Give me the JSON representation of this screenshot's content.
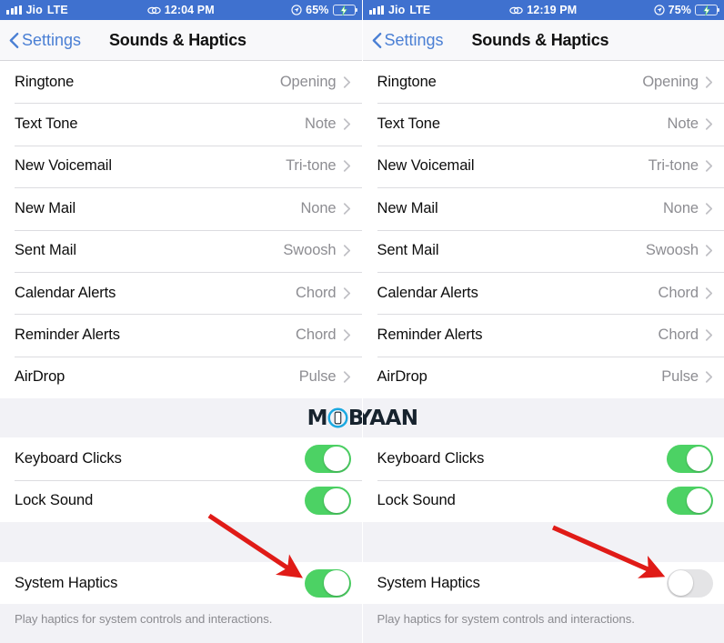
{
  "screens": [
    {
      "id": "before",
      "status_bar": {
        "signal_icon": "signal-bars-icon",
        "carrier": "Jio",
        "network": "LTE",
        "link_icon": "link-icon",
        "time": "12:04 PM",
        "location_icon": "location-arrow-icon",
        "battery_percent": "65%",
        "battery_icon": "battery-charging-icon",
        "battery_level": 65,
        "bar_color": "#3f71cf",
        "battery_fill_color": "#4cd55f"
      },
      "nav": {
        "back_icon": "chevron-left-icon",
        "back_label": "Settings",
        "title": "Sounds & Haptics"
      },
      "sound_rows": [
        {
          "label": "Ringtone",
          "value": "Opening",
          "accessory": "disclosure-chevron-icon"
        },
        {
          "label": "Text Tone",
          "value": "Note",
          "accessory": "disclosure-chevron-icon"
        },
        {
          "label": "New Voicemail",
          "value": "Tri-tone",
          "accessory": "disclosure-chevron-icon"
        },
        {
          "label": "New Mail",
          "value": "None",
          "accessory": "disclosure-chevron-icon"
        },
        {
          "label": "Sent Mail",
          "value": "Swoosh",
          "accessory": "disclosure-chevron-icon"
        },
        {
          "label": "Calendar Alerts",
          "value": "Chord",
          "accessory": "disclosure-chevron-icon"
        },
        {
          "label": "Reminder Alerts",
          "value": "Chord",
          "accessory": "disclosure-chevron-icon"
        },
        {
          "label": "AirDrop",
          "value": "Pulse",
          "accessory": "disclosure-chevron-icon"
        }
      ],
      "toggle_rows": [
        {
          "label": "Keyboard Clicks",
          "state": "on",
          "state_label": "On"
        },
        {
          "label": "Lock Sound",
          "state": "on",
          "state_label": "On"
        }
      ],
      "haptics_row": {
        "label": "System Haptics",
        "state": "on",
        "state_label": "On"
      },
      "footer_text": "Play haptics for system controls and interactions.",
      "annotation": {
        "type": "arrow",
        "color": "#e01b17",
        "points": "from upper-left to System Haptics toggle"
      }
    },
    {
      "id": "after",
      "status_bar": {
        "signal_icon": "signal-bars-icon",
        "carrier": "Jio",
        "network": "LTE",
        "link_icon": "link-icon",
        "time": "12:19 PM",
        "location_icon": "location-arrow-icon",
        "battery_percent": "75%",
        "battery_icon": "battery-charging-icon",
        "battery_level": 75,
        "bar_color": "#3f71cf",
        "battery_fill_color": "#4cd55f"
      },
      "nav": {
        "back_icon": "chevron-left-icon",
        "back_label": "Settings",
        "title": "Sounds & Haptics"
      },
      "sound_rows": [
        {
          "label": "Ringtone",
          "value": "Opening",
          "accessory": "disclosure-chevron-icon"
        },
        {
          "label": "Text Tone",
          "value": "Note",
          "accessory": "disclosure-chevron-icon"
        },
        {
          "label": "New Voicemail",
          "value": "Tri-tone",
          "accessory": "disclosure-chevron-icon"
        },
        {
          "label": "New Mail",
          "value": "None",
          "accessory": "disclosure-chevron-icon"
        },
        {
          "label": "Sent Mail",
          "value": "Swoosh",
          "accessory": "disclosure-chevron-icon"
        },
        {
          "label": "Calendar Alerts",
          "value": "Chord",
          "accessory": "disclosure-chevron-icon"
        },
        {
          "label": "Reminder Alerts",
          "value": "Chord",
          "accessory": "disclosure-chevron-icon"
        },
        {
          "label": "AirDrop",
          "value": "Pulse",
          "accessory": "disclosure-chevron-icon"
        }
      ],
      "toggle_rows": [
        {
          "label": "Keyboard Clicks",
          "state": "on",
          "state_label": "On"
        },
        {
          "label": "Lock Sound",
          "state": "on",
          "state_label": "On"
        }
      ],
      "haptics_row": {
        "label": "System Haptics",
        "state": "off",
        "state_label": "Off"
      },
      "footer_text": "Play haptics for system controls and interactions.",
      "annotation": {
        "type": "arrow",
        "color": "#e01b17",
        "points": "from upper-left to System Haptics toggle"
      }
    }
  ],
  "watermark": {
    "text_before": "M",
    "logo_icon": "mobigyaan-phone-circle-icon",
    "text_after": "BIGYAAN",
    "full_text": "MOBIGYAAN",
    "accent_color": "#1aa8e0",
    "text_color": "#17232e"
  },
  "colors": {
    "status_bar_blue": "#3f71cf",
    "tint_blue": "#4a7fd4",
    "toggle_on_green": "#4cd264",
    "toggle_off_gray": "#e4e4e6",
    "list_background": "#f2f2f6",
    "value_gray": "#8d8d92",
    "annotation_red": "#e01b17"
  }
}
